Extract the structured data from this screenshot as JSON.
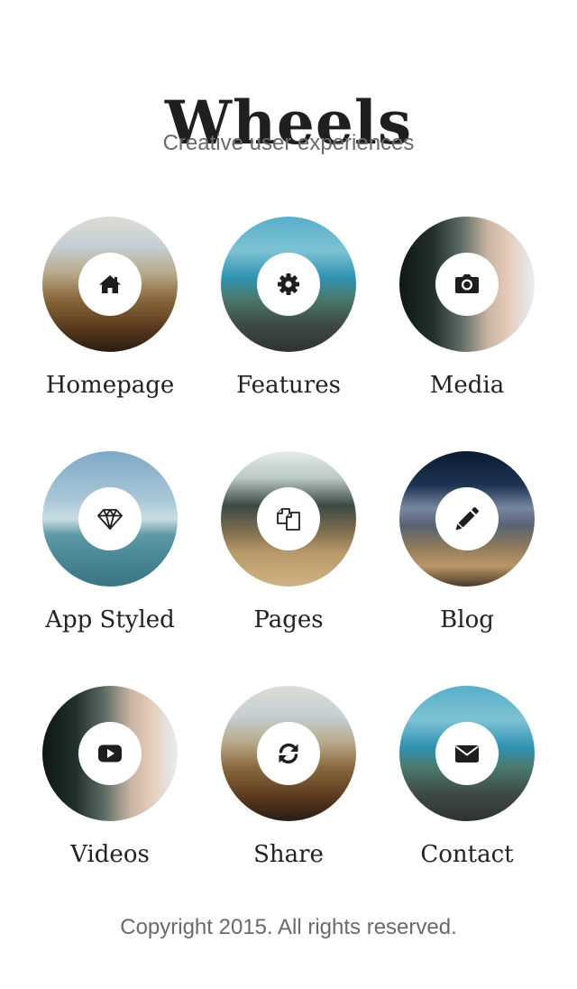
{
  "header": {
    "title": "Wheels",
    "subtitle": "Creative user experiences"
  },
  "menu": [
    {
      "label": "Homepage",
      "icon": "home-icon",
      "background": "beach"
    },
    {
      "label": "Features",
      "icon": "gear-icon",
      "background": "sea"
    },
    {
      "label": "Media",
      "icon": "camera-icon",
      "background": "portrait"
    },
    {
      "label": "App Styled",
      "icon": "diamond-icon",
      "background": "sky"
    },
    {
      "label": "Pages",
      "icon": "pages-icon",
      "background": "cliff"
    },
    {
      "label": "Blog",
      "icon": "pencil-icon",
      "background": "night"
    },
    {
      "label": "Videos",
      "icon": "youtube-play-icon",
      "background": "portrait"
    },
    {
      "label": "Share",
      "icon": "refresh-icon",
      "background": "beach"
    },
    {
      "label": "Contact",
      "icon": "envelope-icon",
      "background": "sea"
    }
  ],
  "footer": {
    "copyright": "Copyright 2015. All rights reserved."
  },
  "colors": {
    "text_dark": "#222222",
    "text_muted": "#6a6a6a",
    "icon": "#1e1e1e",
    "badge": "#ffffff"
  }
}
